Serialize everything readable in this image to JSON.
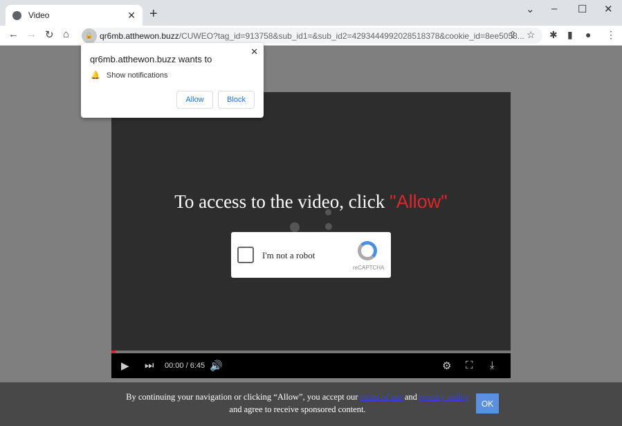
{
  "browser": {
    "tab_title": "Video",
    "url_host": "qr6mb.atthewon.buzz",
    "url_rest": "/CUWEO?tag_id=913758&sub_id1=&sub_id2=4293444992028518378&cookie_id=8ee5058..."
  },
  "popup": {
    "title": "qr6mb.atthewon.buzz wants to",
    "permission": "Show notifications",
    "allow": "Allow",
    "block": "Block"
  },
  "video": {
    "headline": "To access to the video, click ",
    "headline_highlight": "\"Allow\"",
    "captcha_label": "I'm not a robot",
    "captcha_brand": "reCAPTCHA",
    "time": "00:00 / 6:45",
    "progress": 0.01
  },
  "banner": {
    "text_before": "By continuing your navigation or clicking “Allow”, you accept our ",
    "terms": "terms of use",
    "and1": " and ",
    "privacy": "privacy policy",
    "text_after": " and agree to receive sponsored content.",
    "ok": "OK"
  },
  "colors": {
    "accent_red": "#e1252a",
    "ok_button": "#5b8fe0"
  }
}
